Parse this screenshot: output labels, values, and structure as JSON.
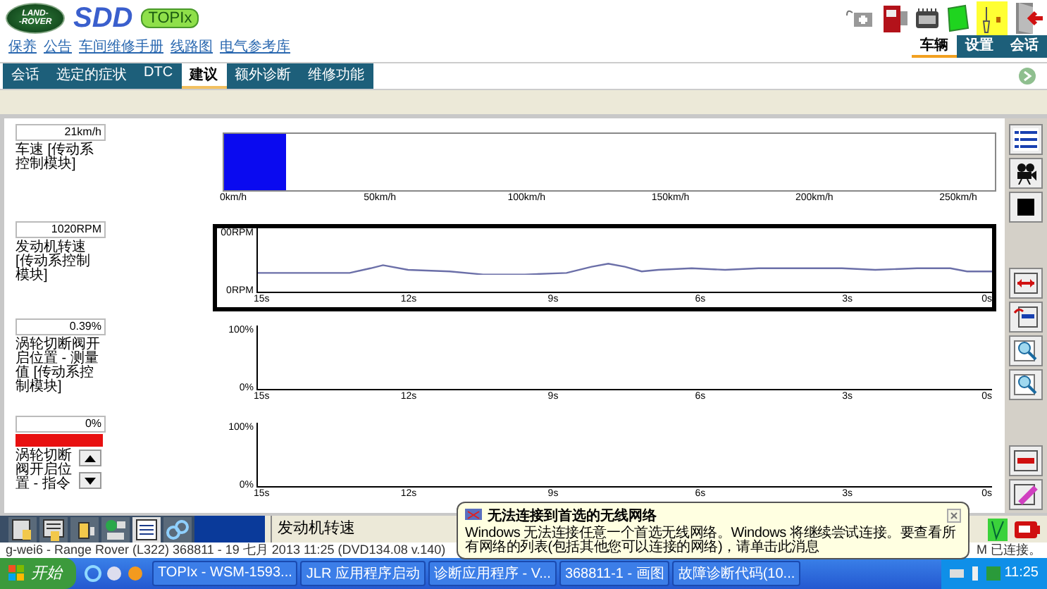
{
  "header": {
    "logo": [
      "LAND-",
      "-ROVER"
    ],
    "brand": "SDD",
    "badge": "TOPIx"
  },
  "links": [
    "保养",
    "公告",
    "车间维修手册",
    "线路图",
    "电气参考库"
  ],
  "top_tabs": [
    {
      "label": "车辆",
      "selected": true
    },
    {
      "label": "设置",
      "selected": false
    },
    {
      "label": "会话",
      "selected": false
    }
  ],
  "tabs": [
    {
      "label": "会话",
      "selected": false
    },
    {
      "label": "选定的症状",
      "selected": false
    },
    {
      "label": "DTC",
      "selected": false
    },
    {
      "label": "建议",
      "selected": true
    },
    {
      "label": "额外诊断",
      "selected": false
    },
    {
      "label": "维修功能",
      "selected": false
    }
  ],
  "gauges": [
    {
      "kind": "bar",
      "reading": "21km/h",
      "label": "车速 [传动系控制模块]",
      "level": 0.08,
      "ticks": [
        "0km/h",
        "50km/h",
        "100km/h",
        "150km/h",
        "200km/h",
        "250km/h"
      ]
    },
    {
      "kind": "trend",
      "reading": "1020RPM",
      "label": "发动机转速 [传动系控制模块]",
      "selected": true,
      "y_max": "00RPM",
      "y_min": "0RPM",
      "has_trace": true,
      "ticks": [
        "15s",
        "12s",
        "9s",
        "6s",
        "3s",
        "0s"
      ]
    },
    {
      "kind": "trend",
      "reading": "0.39%",
      "label": "涡轮切断阀开启位置 - 测量值 [传动系控制模块]",
      "selected": false,
      "y_max": "100%",
      "y_min": "0%",
      "has_trace": false,
      "ticks": [
        "15s",
        "12s",
        "9s",
        "6s",
        "3s",
        "0s"
      ]
    },
    {
      "kind": "trend",
      "reading": "0%",
      "alert": true,
      "scroll": true,
      "label": "涡轮切断阀开启位置 - 指令",
      "selected": false,
      "y_max": "100%",
      "y_min": "0%",
      "has_trace": false,
      "ticks": [
        "15s",
        "12s",
        "9s",
        "6s",
        "3s",
        "0s"
      ]
    }
  ],
  "selected_signal": "发动机转速",
  "status": "g-wei6 - Range Rover (L322) 368811 - 19 七月 2013 11:25 (DVD134.08 v.140)",
  "status_right": "M 已连接。",
  "taskbar": {
    "start": "开始",
    "tasks": [
      "TOPIx - WSM-1593...",
      "JLR 应用程序启动",
      "诊断应用程序 - V...",
      "368811-1 - 画图",
      "故障诊断代码(10..."
    ],
    "clock": "11:25"
  },
  "balloon": {
    "title": "无法连接到首选的无线网络",
    "body": "Windows 无法连接任意一个首选无线网络。Windows 将继续尝试连接。要查看所有网络的列表(包括其他您可以连接的网络)，请单击此消息"
  }
}
